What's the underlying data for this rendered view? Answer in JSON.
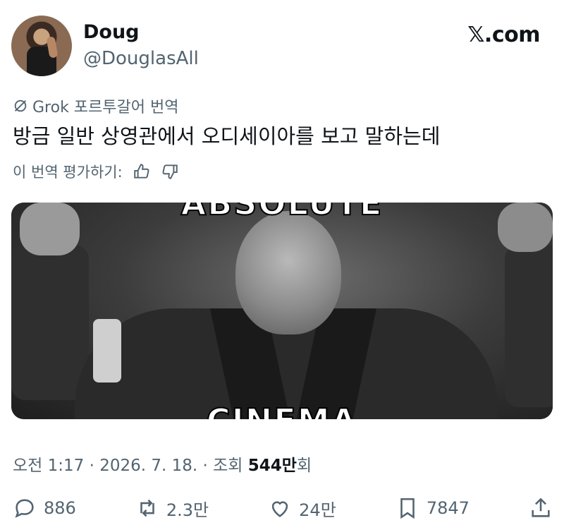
{
  "user": {
    "name": "Doug",
    "handle": "@DouglasAll"
  },
  "site": "𝕏.com",
  "translation": {
    "tag": "Grok 포르투갈어 번역",
    "text": "방금 일반 상영관에서 오디세이아를 보고 말하는데",
    "rate_label": "이 번역 평가하기:"
  },
  "media": {
    "top_caption": "ABSOLUTE",
    "bottom_caption": "CINEMA"
  },
  "meta": {
    "time": "오전 1:17 · 2026. 7. 18. · 조회 ",
    "views": "544만",
    "views_suffix": "회"
  },
  "actions": {
    "replies": "886",
    "reposts": "2.3만",
    "likes": "24만",
    "bookmarks": "7847"
  },
  "icons": [
    "grok-icon",
    "thumbs-up-icon",
    "thumbs-down-icon",
    "reply-icon",
    "repost-icon",
    "like-icon",
    "bookmark-icon",
    "share-icon"
  ]
}
